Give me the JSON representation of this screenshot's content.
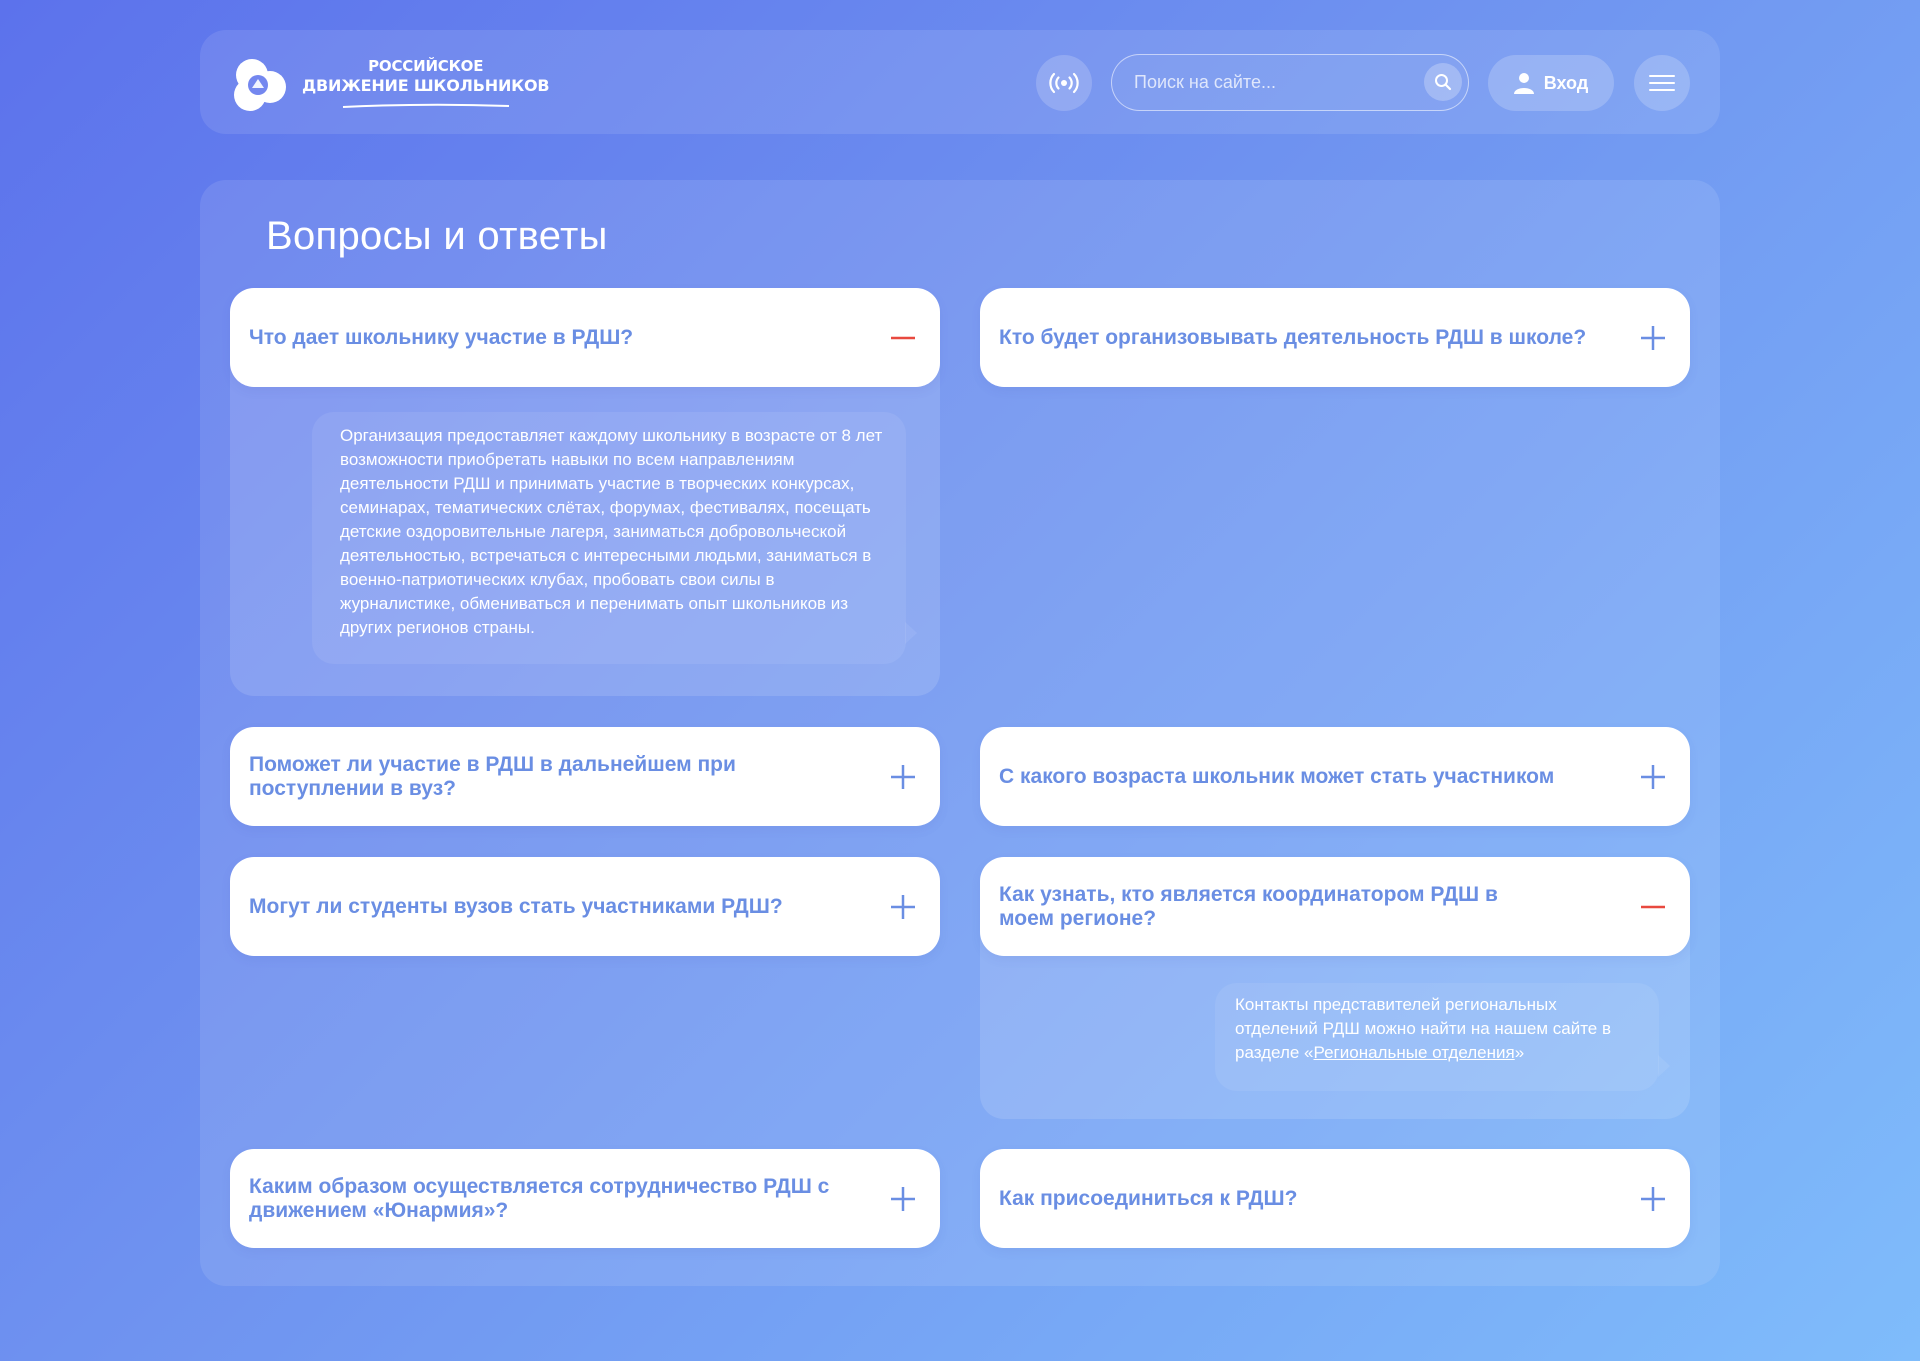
{
  "header": {
    "logo_line1": "РОССИЙСКОЕ",
    "logo_line2": "ДВИЖЕНИЕ ШКОЛЬНИКОВ",
    "search_placeholder": "Поиск на сайте...",
    "login_label": "Вход"
  },
  "page": {
    "title": "Вопросы и ответы"
  },
  "faq": [
    {
      "question": "Что дает школьнику участие в РДШ?",
      "state": "open",
      "answer": "Организация предоставляет каждому школьнику в возрасте от 8 лет возможности приобретать навыки по всем направлениям деятельности РДШ и принимать участие в творческих конкурсах, семинарах, тематических слётах, форумах, фестивалях, посещать детские оздоровительные лагеря, заниматься добровольческой деятельностью, встречаться с интересными людьми, заниматься в военно-патриотических клубах, пробовать свои силы в журналистике, обмениваться и перенимать опыт школьников из других регионов страны."
    },
    {
      "question": "Кто будет организовывать деятельность РДШ в школе?",
      "state": "closed"
    },
    {
      "question": "Поможет ли участие в РДШ в дальнейшем при поступлении в вуз?",
      "state": "closed"
    },
    {
      "question": "С какого возраста школьник может стать участником",
      "state": "closed"
    },
    {
      "question": "Могут ли студенты вузов стать участниками РДШ?",
      "state": "closed"
    },
    {
      "question": "Как узнать, кто является координатором РДШ в моем регионе?",
      "state": "open",
      "answer_before": "Контакты представителей региональных отделений РДШ можно найти на нашем сайте в разделе «",
      "answer_link": "Региональные отделения",
      "answer_after": "»"
    },
    {
      "question": "Каким образом осуществляется сотрудничество РДШ с движением «Юнармия»?",
      "state": "closed"
    },
    {
      "question": "Как присоединиться к РДШ?",
      "state": "closed"
    }
  ],
  "colors": {
    "question_text": "#6a8ee3",
    "plus_icon": "#6a8ee3",
    "minus_icon": "#e8493f",
    "bg_start": "#5c72ec",
    "bg_end": "#7fbcfb"
  },
  "icons": {
    "radio": "radio-broadcast-icon",
    "search": "magnifier-icon",
    "user": "user-icon",
    "menu": "hamburger-icon",
    "expand": "plus-icon",
    "collapse": "minus-icon"
  }
}
